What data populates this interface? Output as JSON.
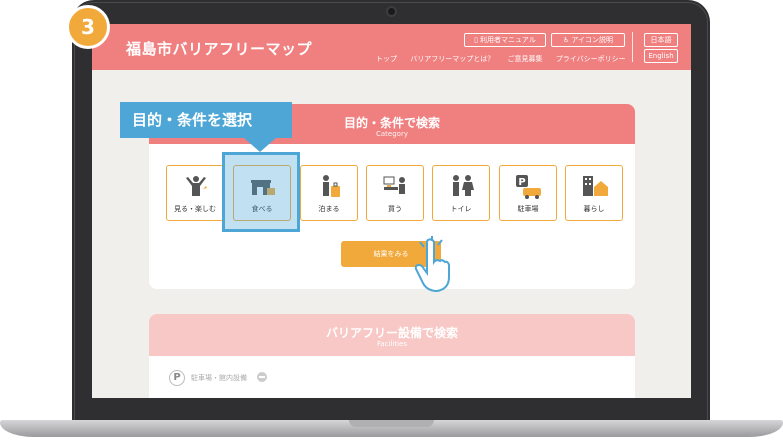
{
  "step": {
    "number": "3"
  },
  "site": {
    "title": "福島市バリアフリーマップ"
  },
  "header_buttons": {
    "manual": "利用者マニュアル",
    "icon_desc": "アイコン説明",
    "lang_ja": "日本語",
    "lang_en": "English"
  },
  "nav": [
    "トップ",
    "バリアフリーマップとは？",
    "ご意見募集",
    "プライバシーポリシー"
  ],
  "category_section": {
    "title": "目的・条件で検索",
    "subtitle": "Category",
    "callout": "目的・条件を選択",
    "items": [
      {
        "label": "見る・楽しむ",
        "icon": "sightseeing-icon"
      },
      {
        "label": "食べる",
        "icon": "restaurant-icon",
        "selected": true
      },
      {
        "label": "泊まる",
        "icon": "hotel-icon"
      },
      {
        "label": "買う",
        "icon": "shopping-icon"
      },
      {
        "label": "トイレ",
        "icon": "toilet-icon"
      },
      {
        "label": "駐車場",
        "icon": "parking-icon"
      },
      {
        "label": "暮らし",
        "icon": "living-icon"
      }
    ],
    "result_button": "結果をみる"
  },
  "facility_section": {
    "title": "バリアフリー設備で検索",
    "subtitle": "Facilities",
    "parking_item": "駐車場・館内設備",
    "parking_badge": "P"
  },
  "colors": {
    "header": "#f08080",
    "accent": "#f2a93b",
    "highlight": "#4da6d6"
  }
}
